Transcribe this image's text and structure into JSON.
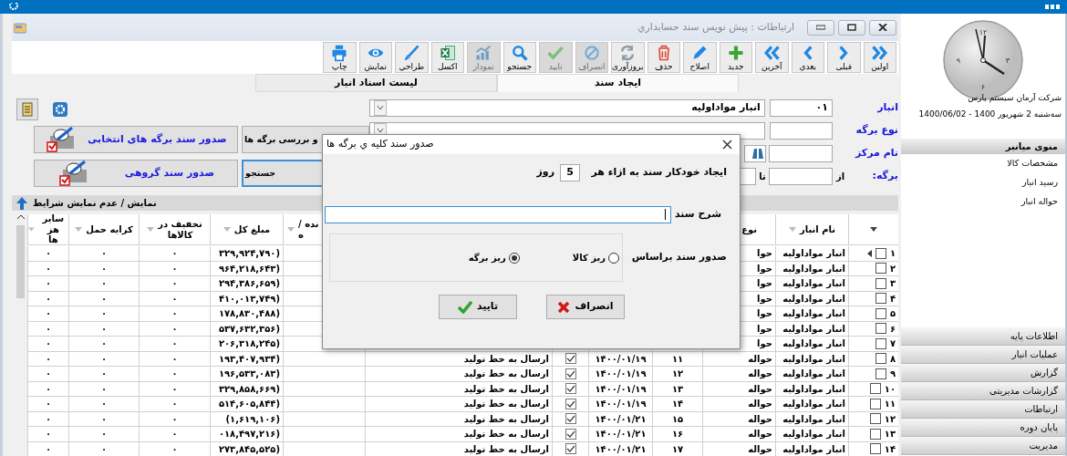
{
  "window": {
    "title": "ارتباطات : پیش نویس سند حسابداري",
    "toolbar": [
      {
        "label": "اولین",
        "kind": "first",
        "disabled": false
      },
      {
        "label": "قبلی",
        "kind": "prev",
        "disabled": false
      },
      {
        "label": "بعدي",
        "kind": "next",
        "disabled": false
      },
      {
        "label": "آخرین",
        "kind": "last",
        "disabled": false
      },
      {
        "label": "جدید",
        "kind": "new",
        "disabled": false
      },
      {
        "label": "اصلاح",
        "kind": "edit",
        "disabled": false
      },
      {
        "label": "حذف",
        "kind": "delete",
        "disabled": false
      },
      {
        "label": "بروزآوری",
        "kind": "refresh",
        "disabled": false
      },
      {
        "label": "انصراف",
        "kind": "cancel",
        "disabled": true
      },
      {
        "label": "تایید",
        "kind": "confirm",
        "disabled": true
      },
      {
        "label": "جستجو",
        "kind": "search",
        "disabled": false
      },
      {
        "label": "نمودار",
        "kind": "chart",
        "disabled": true
      },
      {
        "label": "اکسل",
        "kind": "excel",
        "disabled": false
      },
      {
        "label": "طراحي",
        "kind": "design",
        "disabled": false
      },
      {
        "label": "نمایش",
        "kind": "view",
        "disabled": false
      },
      {
        "label": "چاپ",
        "kind": "print",
        "disabled": false
      }
    ],
    "tabs": [
      {
        "label": "ایجاد سند",
        "selected": true
      },
      {
        "label": "لیست اسناد انبار",
        "selected": false
      }
    ],
    "form": {
      "warehouse_label": "انبار",
      "warehouse_code": "۰۱",
      "warehouse_name": "انبار مواداولیه",
      "doc_type_label": "نوع برگه",
      "center_label": "نام مرکز",
      "sheet_label": "برگه:",
      "from_label": "از",
      "to_label": "تا",
      "buttons": [
        {
          "label": "و بررسی برگه ها",
          "kind": "plain",
          "focused": false
        },
        {
          "label": "صدور سند برگه های انتخابی",
          "kind": "issue",
          "focused": false
        },
        {
          "label": "جستجو",
          "kind": "plain",
          "focused": true
        },
        {
          "label": "صدور سند گروهی",
          "kind": "issue",
          "focused": false
        }
      ]
    },
    "conditions_toggle": "نمایش / عدم نمایش شرایط",
    "grid": {
      "headers": {
        "warehouse": "نام انبار",
        "type": "نوع",
        "column_8": "نده /\nه",
        "amount": "مبلغ کل",
        "discount": "تخفیف در\nکالاها",
        "freight": "کرایه حمل",
        "other": "سایر هز\nها"
      },
      "rows": [
        {
          "number": "۱",
          "selected": true,
          "checked": false,
          "warehouse": "انبار مواداولیه",
          "type": "حوا",
          "amount": "۳۲۹,۹۲۴,۷۹۰)",
          "discount": "۰",
          "freight": "۰",
          "other": "۰"
        },
        {
          "number": "۲",
          "selected": false,
          "checked": false,
          "warehouse": "انبار مواداولیه",
          "type": "حوا",
          "amount": "۹۶۴,۲۱۸,۶۴۳)",
          "discount": "۰",
          "freight": "۰",
          "other": "۰"
        },
        {
          "number": "۳",
          "selected": false,
          "checked": false,
          "warehouse": "انبار مواداولیه",
          "type": "حوا",
          "amount": "۲۹۴,۳۸۶,۶۵۹)",
          "discount": "۰",
          "freight": "۰",
          "other": "۰"
        },
        {
          "number": "۴",
          "selected": false,
          "checked": false,
          "warehouse": "انبار مواداولیه",
          "type": "حوا",
          "amount": "۴۱۰,۰۱۳,۷۴۹)",
          "discount": "۰",
          "freight": "۰",
          "other": "۰"
        },
        {
          "number": "۵",
          "selected": false,
          "checked": false,
          "warehouse": "انبار مواداولیه",
          "type": "حوا",
          "amount": "۱۷۸,۸۳۰,۴۸۸)",
          "discount": "۰",
          "freight": "۰",
          "other": "۰"
        },
        {
          "number": "۶",
          "selected": false,
          "checked": false,
          "warehouse": "انبار مواداولیه",
          "type": "حوا",
          "amount": "۵۳۷,۶۳۲,۳۵۶)",
          "discount": "۰",
          "freight": "۰",
          "other": "۰"
        },
        {
          "number": "۷",
          "selected": false,
          "checked": false,
          "warehouse": "انبار مواداولیه",
          "type": "حوا",
          "amount": "۲۰۶,۳۱۸,۲۴۵)",
          "discount": "۰",
          "freight": "۰",
          "other": "۰"
        },
        {
          "number": "۸",
          "selected": false,
          "checked": false,
          "warehouse": "انبار مواداولیه",
          "type": "حواله",
          "column_4": "۱۱",
          "date": "۱۴۰۰/۰۱/۱۹",
          "confirmed": true,
          "description": "ارسال به خط تولید",
          "amount": "۱۹۳,۴۰۷,۹۳۴)",
          "discount": "۰",
          "freight": "۰",
          "other": "۰"
        },
        {
          "number": "۹",
          "selected": false,
          "checked": false,
          "warehouse": "انبار مواداولیه",
          "type": "حواله",
          "column_4": "۱۲",
          "date": "۱۴۰۰/۰۱/۱۹",
          "confirmed": true,
          "description": "ارسال به خط تولید",
          "amount": "۱۹۶,۵۳۳,۰۸۳)",
          "discount": "۰",
          "freight": "۰",
          "other": "۰"
        },
        {
          "number": "۱۰",
          "selected": false,
          "checked": false,
          "warehouse": "انبار مواداولیه",
          "type": "حواله",
          "column_4": "۱۳",
          "date": "۱۴۰۰/۰۱/۱۹",
          "confirmed": true,
          "description": "ارسال به خط تولید",
          "amount": "۳۲۹,۸۵۸,۶۶۹)",
          "discount": "۰",
          "freight": "۰",
          "other": "۰"
        },
        {
          "number": "۱۱",
          "selected": false,
          "checked": false,
          "warehouse": "انبار مواداولیه",
          "type": "حواله",
          "column_4": "۱۴",
          "date": "۱۴۰۰/۰۱/۱۹",
          "confirmed": true,
          "description": "ارسال به خط تولید",
          "amount": "۵۱۴,۶۰۵,۸۴۴)",
          "discount": "۰",
          "freight": "۰",
          "other": "۰"
        },
        {
          "number": "۱۲",
          "selected": false,
          "checked": false,
          "warehouse": "انبار مواداولیه",
          "type": "حواله",
          "column_4": "۱۵",
          "date": "۱۴۰۰/۰۱/۲۱",
          "confirmed": true,
          "description": "ارسال به خط تولید",
          "amount": "(۱,۶۱۹,۱۰۶)",
          "discount": "۰",
          "freight": "۰",
          "other": "۰"
        },
        {
          "number": "۱۳",
          "selected": false,
          "checked": false,
          "warehouse": "انبار مواداولیه",
          "type": "حواله",
          "column_4": "۱۶",
          "date": "۱۴۰۰/۰۱/۲۱",
          "confirmed": true,
          "description": "ارسال به خط تولید",
          "amount": "۰۱۸,۴۹۷,۲۱۶)",
          "discount": "۰",
          "freight": "۰",
          "other": "۰"
        },
        {
          "number": "۱۴",
          "selected": false,
          "checked": false,
          "warehouse": "انبار مواداولیه",
          "type": "حواله",
          "column_4": "۱۷",
          "date": "۱۴۰۰/۰۱/۲۱",
          "confirmed": true,
          "description": "ارسال به خط تولید",
          "amount": "۲۷۳,۸۴۵,۵۲۵)",
          "discount": "۰",
          "freight": "۰",
          "other": "۰"
        }
      ]
    }
  },
  "dialog": {
    "title": "صدور سند کلیه ي برگه ها",
    "auto_label": "ایجاد خودکار سند به ازاء هر",
    "auto_days": "5",
    "days_unit": "روز",
    "description_label": "شرح سند",
    "basis_label": "صدور سند براساس",
    "options": [
      {
        "label": "ریز کالا",
        "selected": false
      },
      {
        "label": "ریز برگه",
        "selected": true
      }
    ],
    "buttons": [
      {
        "label": "انصراف",
        "kind": "cancel"
      },
      {
        "label": "تایید",
        "kind": "confirm"
      }
    ]
  },
  "sidebar": {
    "clock_numerals": [
      "۱۲",
      "۳",
      "۶",
      "۹"
    ],
    "company": "شرکت آرمان سیستم پارس",
    "date": "سه‌شنبه 2 شهریور 1400 - 1400/06/02",
    "shortcut_header": "منوی میانبر",
    "shortcuts": [
      "مشخصات کالا",
      "رسید انبار",
      "حواله انبار"
    ],
    "sections": [
      "اطلاعات پایه",
      "عملیات انبار",
      "گزارش",
      "گزارشات مدیریتی",
      "ارتباطات",
      "پایان دوره",
      "مدیریت"
    ]
  }
}
